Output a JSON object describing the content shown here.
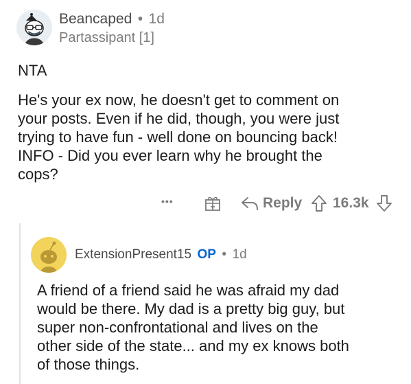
{
  "comment": {
    "username": "Beancaped",
    "separator": "•",
    "age": "1d",
    "flair": "Partassipant [1]",
    "verdict": "NTA",
    "body_lines": [
      "He's your ex now, he doesn't get to comment on",
      "your posts. Even if he did, though, you were just",
      "trying to have fun - well done on bouncing back!",
      "INFO - Did you ever learn why he brought the",
      "cops?"
    ],
    "actions": {
      "more_label": "•••",
      "reply_label": "Reply",
      "score": "16.3k"
    }
  },
  "reply": {
    "username": "ExtensionPresent15",
    "op_badge": "OP",
    "separator": "•",
    "age": "1d",
    "body_lines": [
      "A friend of a friend said he was afraid my dad",
      "would be there.  My dad is a pretty big guy, but",
      "super non-confrontational and lives on the",
      "other side of the state... and my ex knows both",
      "of those things."
    ]
  },
  "colors": {
    "text": "#1c1c1c",
    "muted": "#7c7c7c",
    "op_blue": "#0a66d0",
    "avatar_yellow": "#f2d35b",
    "thread_line": "#e3e3e3"
  },
  "icons": [
    "snoo-avatar-icon",
    "more-options-icon",
    "award-gift-icon",
    "reply-arrow-icon",
    "upvote-arrow-icon",
    "downvote-arrow-icon"
  ]
}
